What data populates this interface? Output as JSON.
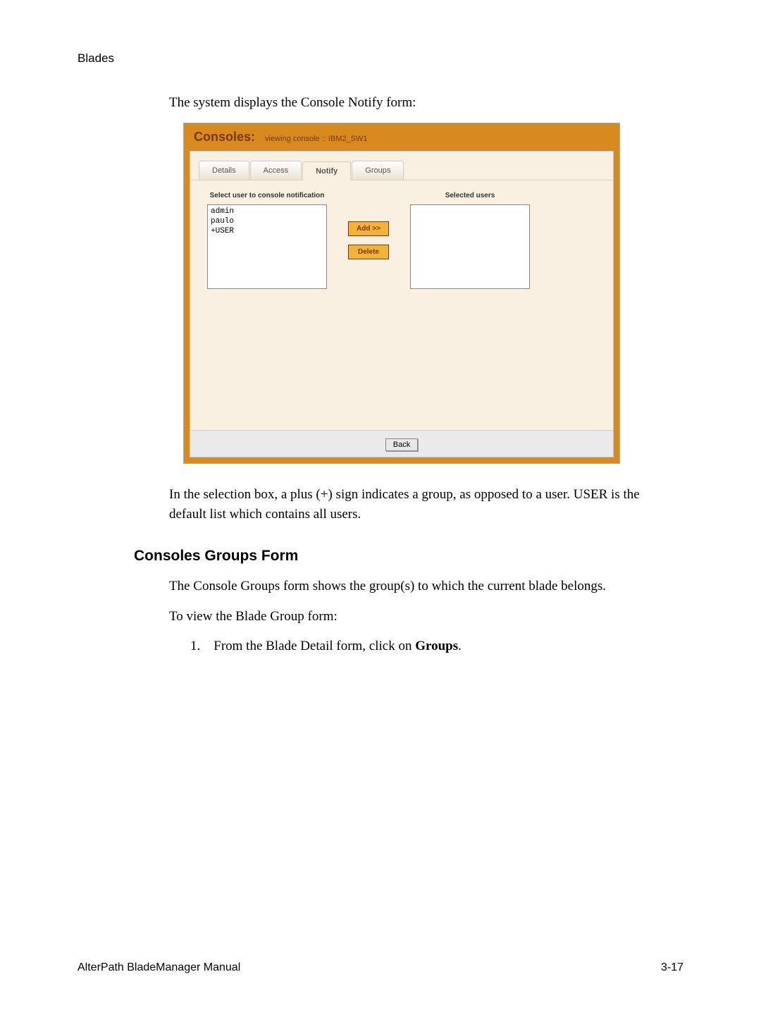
{
  "section_label": "Blades",
  "intro_text": "The system displays the Console Notify form:",
  "screenshot": {
    "title": "Consoles:",
    "subtitle": "viewing console  ::  IBM2_SW1",
    "tabs": [
      "Details",
      "Access",
      "Notify",
      "Groups"
    ],
    "active_tab": "Notify",
    "left_label": "Select user to console notification",
    "right_label": "Selected users",
    "available_users": [
      "admin",
      "paulo",
      "+USER"
    ],
    "selected_users": [],
    "add_button": "Add >>",
    "delete_button": "Delete",
    "back_button": "Back"
  },
  "after_text": "In the selection box, a plus (+) sign indicates a group, as opposed to a user. USER is the default list which contains all users.",
  "heading": "Consoles Groups Form",
  "p2": "The Console Groups form shows the group(s) to which the current blade belongs.",
  "p3": "To view the Blade Group form:",
  "step1_prefix": "1. From the Blade Detail form, click on ",
  "step1_bold": "Groups",
  "step1_suffix": ".",
  "footer_left": "AlterPath BladeManager Manual",
  "footer_right": "3-17"
}
